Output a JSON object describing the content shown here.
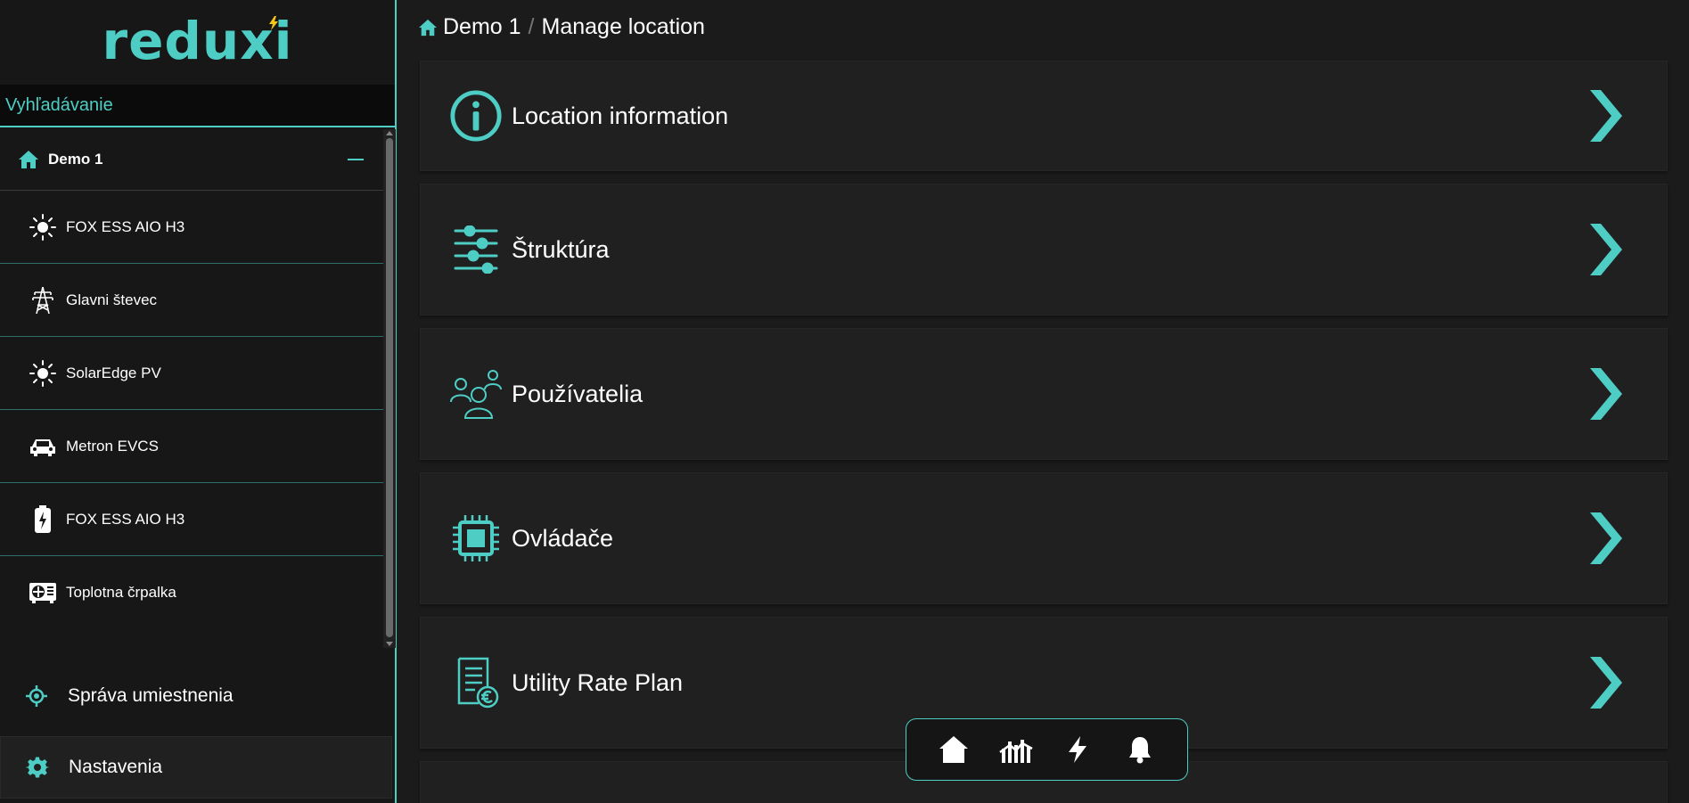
{
  "app": {
    "logo_text": "reduxi"
  },
  "search": {
    "placeholder": "Vyhľadávanie"
  },
  "tree": {
    "root_label": "Demo 1",
    "devices": [
      {
        "label": "FOX ESS AIO H3",
        "icon": "sun-icon"
      },
      {
        "label": "Glavni števec",
        "icon": "power-tower-icon"
      },
      {
        "label": "SolarEdge PV",
        "icon": "sun-icon"
      },
      {
        "label": "Metron EVCS",
        "icon": "car-icon"
      },
      {
        "label": "FOX ESS AIO H3",
        "icon": "battery-icon"
      },
      {
        "label": "Toplotna črpalka",
        "icon": "heat-pump-icon"
      }
    ]
  },
  "side_nav": {
    "location_label": "Správa umiestnenia",
    "settings_label": "Nastavenia"
  },
  "breadcrumb": {
    "home": "Demo 1",
    "current": "Manage location"
  },
  "cards": [
    {
      "title": "Location information",
      "icon": "info-icon"
    },
    {
      "title": "Štruktúra",
      "icon": "sliders-icon"
    },
    {
      "title": "Používatelia",
      "icon": "users-icon"
    },
    {
      "title": "Ovládače",
      "icon": "chip-icon"
    },
    {
      "title": "Utility Rate Plan",
      "icon": "invoice-euro-icon"
    }
  ],
  "bottom_bar": [
    "home-icon",
    "chart-icon",
    "bolt-icon",
    "bell-icon"
  ],
  "colors": {
    "accent": "#4ecdc4",
    "background": "#1b1b1b",
    "card": "#202020",
    "sidebar": "#171717"
  }
}
